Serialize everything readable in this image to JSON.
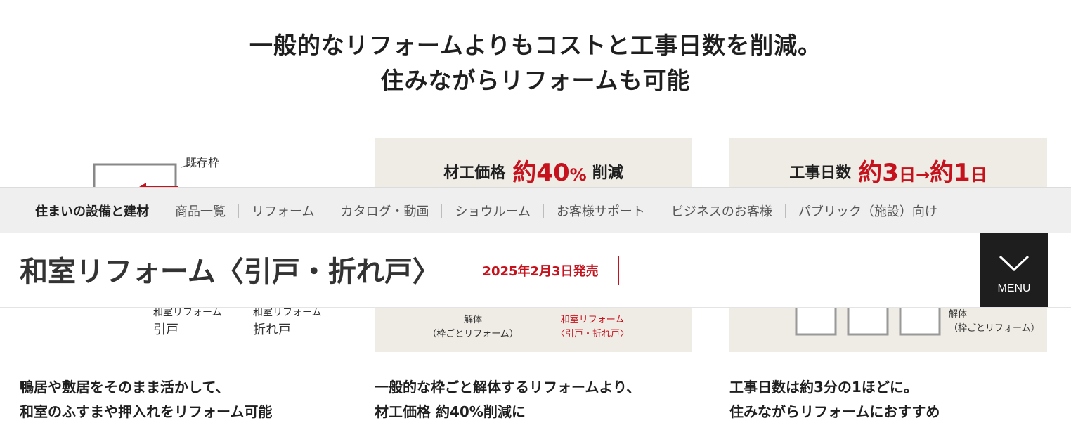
{
  "hero": {
    "line1": "一般的なリフォームよりもコストと工事日数を削減。",
    "line2": "住みながらリフォームも可能"
  },
  "cards": [
    {
      "frame_label": "既存枠",
      "caption_a_line1": "和室リフォーム",
      "caption_a_line2": "引戸",
      "caption_b_line1": "和室リフォーム",
      "caption_b_line2": "折れ戸",
      "desc_line1": "鴨居や敷居をそのまま活かして、",
      "desc_line2": "和室のふすまや押入れをリフォーム可能"
    },
    {
      "head_label": "材工価格",
      "head_big": "約40",
      "head_unit": "%",
      "head_tail": "削減",
      "caption_a_line1": "解体",
      "caption_a_line2": "（枠ごとリフォーム）",
      "caption_b_line1": "和室リフォーム",
      "caption_b_line2": "〈引戸・折れ戸〉",
      "desc_line1": "一般的な枠ごと解体するリフォームより、",
      "desc_line2": "材工価格 約40%削減に"
    },
    {
      "head_label": "工事日数",
      "head_big": "約3",
      "head_unit": "日",
      "head_arrow": "→",
      "head_big2": "約1",
      "head_unit2": "日",
      "caption_a_line1": "解体",
      "caption_a_line2": "（枠ごとリフォーム）",
      "desc_line1": "工事日数は約3分の1ほどに。",
      "desc_line2": "住みながらリフォームにおすすめ"
    }
  ],
  "nav": {
    "items": [
      "住まいの設備と建材",
      "商品一覧",
      "リフォーム",
      "カタログ・動画",
      "ショウルーム",
      "お客様サポート",
      "ビジネスのお客様",
      "パブリック（施設）向け"
    ]
  },
  "titlebar": {
    "title": "和室リフォーム〈引戸・折れ戸〉",
    "badge": "2025年2月3日発売",
    "menu_label": "MENU",
    "menu_icon": "chevron-down-icon"
  },
  "colors": {
    "accent_red": "#c6121d",
    "nav_bg": "#efefef",
    "card_bg": "#efece5",
    "menu_bg": "#1e1e1e"
  }
}
